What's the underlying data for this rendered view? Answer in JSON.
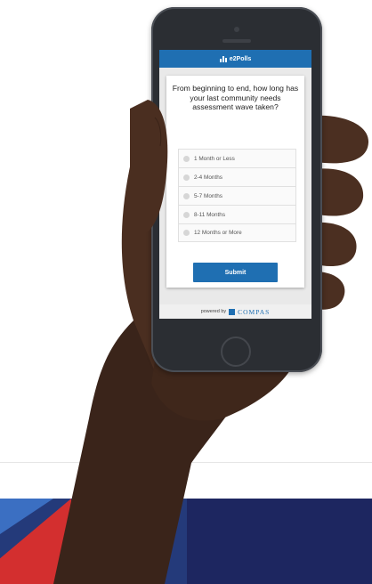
{
  "app": {
    "brand": "e2Polls"
  },
  "poll": {
    "question": "From beginning to end, how long has your last community needs assessment wave taken?",
    "options": [
      {
        "label": "1 Month or Less"
      },
      {
        "label": "2-4 Months"
      },
      {
        "label": "5-7 Months"
      },
      {
        "label": "8-11 Months"
      },
      {
        "label": "12 Months or More"
      }
    ],
    "submit_label": "Submit"
  },
  "footer": {
    "powered_by": "powered by",
    "partner": "COMPAS"
  },
  "colors": {
    "accent": "#1f6fb2",
    "band_blue": "#243a7a",
    "band_red": "#d32f2f"
  }
}
